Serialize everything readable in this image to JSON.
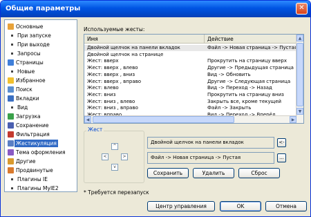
{
  "window": {
    "title": "Общие параметры",
    "close_symbol": "✕"
  },
  "sidebar": {
    "items": [
      {
        "label": "Основные",
        "icon": "checklist-icon",
        "color": "#e8a23a",
        "level": 0
      },
      {
        "label": "При запуске",
        "level": 1
      },
      {
        "label": "При выходе",
        "level": 1
      },
      {
        "label": "Запросы",
        "level": 1
      },
      {
        "label": "Страницы",
        "icon": "pages-icon",
        "color": "#3f7fd9",
        "level": 0
      },
      {
        "label": "Новые",
        "level": 1
      },
      {
        "label": "Избранное",
        "icon": "star-icon",
        "color": "#f2c12e",
        "level": 0
      },
      {
        "label": "Поиск",
        "icon": "search-icon",
        "color": "#5a8fd0",
        "level": 0
      },
      {
        "label": "Вкладки",
        "icon": "tabs-icon",
        "color": "#3a6fc2",
        "level": 0
      },
      {
        "label": "Вид",
        "level": 1
      },
      {
        "label": "Загрузка",
        "icon": "download-icon",
        "color": "#3aa14a",
        "level": 0
      },
      {
        "label": "Сохранение",
        "icon": "save-icon",
        "color": "#4a5fb0",
        "level": 0
      },
      {
        "label": "Фильтрация",
        "icon": "filter-icon",
        "color": "#c43a2f",
        "level": 0
      },
      {
        "label": "Жестикуляция",
        "icon": "gesture-icon",
        "color": "#5a7fc4",
        "level": 0,
        "selected": true
      },
      {
        "label": "Тема оформления",
        "icon": "theme-icon",
        "color": "#8a5ac4",
        "level": 0
      },
      {
        "label": "Другие",
        "icon": "other-icon",
        "color": "#d99a2e",
        "level": 0
      },
      {
        "label": "Продвинутые",
        "icon": "advanced-icon",
        "color": "#d97a2e",
        "level": 0
      },
      {
        "label": "Плагины IE",
        "level": 1
      },
      {
        "label": "Плагины MyIE2",
        "level": 1
      }
    ]
  },
  "gestures": {
    "section_label": "Используемые жесты:",
    "columns": {
      "name": "Имя",
      "action": "Действие"
    },
    "rows": [
      {
        "name": "Двойной щелчок на панели вкладок",
        "action": "Файл -> Новая страница -> Пустая",
        "selected": true
      },
      {
        "name": "Двойной щелчок на странице",
        "action": ""
      },
      {
        "name": "Жест: вверх",
        "action": "Прокрутить на страницу вверх"
      },
      {
        "name": "Жест: вверх , влево",
        "action": "Другие -> Предыдущая страница"
      },
      {
        "name": "Жест: вверх , вниз",
        "action": "Вид -> Обновить"
      },
      {
        "name": "Жест: вверх , вправо",
        "action": "Другие -> Следующая страница"
      },
      {
        "name": "Жест: влево",
        "action": "Вид -> Переход -> Назад"
      },
      {
        "name": "Жест: вниз",
        "action": "Прокрутить на страницу вниз"
      },
      {
        "name": "Жест: вниз , влево",
        "action": "Закрыть все, кроме текущей"
      },
      {
        "name": "Жест: вниз , вправо",
        "action": "Файл -> Закрыть"
      },
      {
        "name": "Жест: вправо",
        "action": "Вид -> Переход -> Вперёд"
      }
    ]
  },
  "gesture_editor": {
    "group_label": "Жест",
    "arrows": {
      "up": "^",
      "left": "<",
      "right": ">",
      "down": "v"
    },
    "name_value": "Двойной щелчок на панели вкладок",
    "backspace_label": "<-",
    "action_value": "Файл -> Новая страница -> Пустая",
    "browse_label": "...",
    "save_label": "Сохранить",
    "delete_label": "Удалить",
    "reset_label": "Сброс"
  },
  "note": "* Требуется перезапуск",
  "footer": {
    "control_center_label": "Центр управления",
    "ok_label": "OK",
    "cancel_label": "Отмена"
  }
}
